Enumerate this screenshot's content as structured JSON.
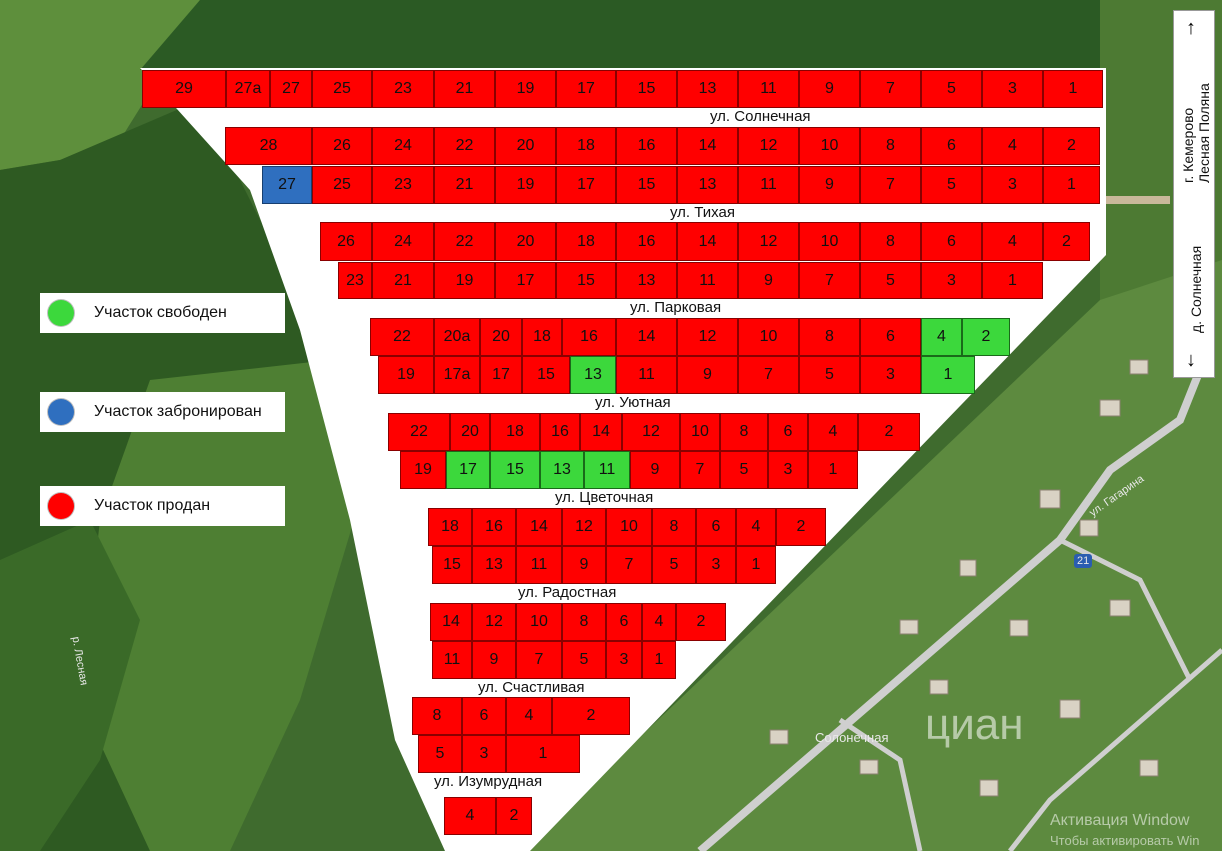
{
  "colors": {
    "sold": "#ff0000",
    "free": "#3cd83c",
    "reserved": "#2f6fbf",
    "street": "#ffffff",
    "forest": "#2e5a22",
    "field": "#5e8f3c"
  },
  "legend": [
    {
      "label": "Участок свободен",
      "color": "#3cd83c"
    },
    {
      "label": "Участок забронирован",
      "color": "#2f6fbf"
    },
    {
      "label": "Участок продан",
      "color": "#ff0000"
    }
  ],
  "streets": [
    "ул. Солнечная",
    "ул. Тихая",
    "ул. Парковая",
    "ул. Уютная",
    "ул. Цветочная",
    "ул. Радостная",
    "ул. Счастливая",
    "ул. Изумрудная"
  ],
  "direction": {
    "top_line1": "г. Кемерово",
    "top_line2": "Лесная Поляна",
    "bottom": "д. Солнечная",
    "up_arrow": "↑",
    "down_arrow": "↓"
  },
  "map_labels": {
    "road": "ул. Гагарина",
    "village_street": "Солонечная",
    "river": "р. Лесная",
    "route": "21"
  },
  "watermark": {
    "brand": "циан",
    "activation_line1": "Активация Window",
    "activation_line2": "Чтобы активировать Win"
  },
  "rows": [
    {
      "plots": [
        {
          "n": "29",
          "s": "sold"
        },
        {
          "n": "27а",
          "s": "sold"
        },
        {
          "n": "27",
          "s": "sold"
        },
        {
          "n": "25",
          "s": "sold"
        },
        {
          "n": "23",
          "s": "sold"
        },
        {
          "n": "21",
          "s": "sold"
        },
        {
          "n": "19",
          "s": "sold"
        },
        {
          "n": "17",
          "s": "sold"
        },
        {
          "n": "15",
          "s": "sold"
        },
        {
          "n": "13",
          "s": "sold"
        },
        {
          "n": "11",
          "s": "sold"
        },
        {
          "n": "9",
          "s": "sold"
        },
        {
          "n": "7",
          "s": "sold"
        },
        {
          "n": "5",
          "s": "sold"
        },
        {
          "n": "3",
          "s": "sold"
        },
        {
          "n": "1",
          "s": "sold"
        }
      ]
    },
    {
      "plots": [
        {
          "n": "28",
          "s": "sold"
        },
        {
          "n": "26",
          "s": "sold"
        },
        {
          "n": "24",
          "s": "sold"
        },
        {
          "n": "22",
          "s": "sold"
        },
        {
          "n": "20",
          "s": "sold"
        },
        {
          "n": "18",
          "s": "sold"
        },
        {
          "n": "16",
          "s": "sold"
        },
        {
          "n": "14",
          "s": "sold"
        },
        {
          "n": "12",
          "s": "sold"
        },
        {
          "n": "10",
          "s": "sold"
        },
        {
          "n": "8",
          "s": "sold"
        },
        {
          "n": "6",
          "s": "sold"
        },
        {
          "n": "4",
          "s": "sold"
        },
        {
          "n": "2",
          "s": "sold"
        }
      ]
    },
    {
      "plots": [
        {
          "n": "27",
          "s": "reserved"
        },
        {
          "n": "25",
          "s": "sold"
        },
        {
          "n": "23",
          "s": "sold"
        },
        {
          "n": "21",
          "s": "sold"
        },
        {
          "n": "19",
          "s": "sold"
        },
        {
          "n": "17",
          "s": "sold"
        },
        {
          "n": "15",
          "s": "sold"
        },
        {
          "n": "13",
          "s": "sold"
        },
        {
          "n": "11",
          "s": "sold"
        },
        {
          "n": "9",
          "s": "sold"
        },
        {
          "n": "7",
          "s": "sold"
        },
        {
          "n": "5",
          "s": "sold"
        },
        {
          "n": "3",
          "s": "sold"
        },
        {
          "n": "1",
          "s": "sold"
        }
      ]
    },
    {
      "plots": [
        {
          "n": "26",
          "s": "sold"
        },
        {
          "n": "24",
          "s": "sold"
        },
        {
          "n": "22",
          "s": "sold"
        },
        {
          "n": "20",
          "s": "sold"
        },
        {
          "n": "18",
          "s": "sold"
        },
        {
          "n": "16",
          "s": "sold"
        },
        {
          "n": "14",
          "s": "sold"
        },
        {
          "n": "12",
          "s": "sold"
        },
        {
          "n": "10",
          "s": "sold"
        },
        {
          "n": "8",
          "s": "sold"
        },
        {
          "n": "6",
          "s": "sold"
        },
        {
          "n": "4",
          "s": "sold"
        },
        {
          "n": "2",
          "s": "sold"
        }
      ]
    },
    {
      "plots": [
        {
          "n": "23",
          "s": "sold"
        },
        {
          "n": "21",
          "s": "sold"
        },
        {
          "n": "19",
          "s": "sold"
        },
        {
          "n": "17",
          "s": "sold"
        },
        {
          "n": "15",
          "s": "sold"
        },
        {
          "n": "13",
          "s": "sold"
        },
        {
          "n": "11",
          "s": "sold"
        },
        {
          "n": "9",
          "s": "sold"
        },
        {
          "n": "7",
          "s": "sold"
        },
        {
          "n": "5",
          "s": "sold"
        },
        {
          "n": "3",
          "s": "sold"
        },
        {
          "n": "1",
          "s": "sold"
        }
      ]
    },
    {
      "plots": [
        {
          "n": "22",
          "s": "sold"
        },
        {
          "n": "20а",
          "s": "sold"
        },
        {
          "n": "20",
          "s": "sold"
        },
        {
          "n": "18",
          "s": "sold"
        },
        {
          "n": "16",
          "s": "sold"
        },
        {
          "n": "14",
          "s": "sold"
        },
        {
          "n": "12",
          "s": "sold"
        },
        {
          "n": "10",
          "s": "sold"
        },
        {
          "n": "8",
          "s": "sold"
        },
        {
          "n": "6",
          "s": "sold"
        },
        {
          "n": "4",
          "s": "free"
        },
        {
          "n": "2",
          "s": "free"
        }
      ]
    },
    {
      "plots": [
        {
          "n": "19",
          "s": "sold"
        },
        {
          "n": "17а",
          "s": "sold"
        },
        {
          "n": "17",
          "s": "sold"
        },
        {
          "n": "15",
          "s": "sold"
        },
        {
          "n": "13",
          "s": "free"
        },
        {
          "n": "11",
          "s": "sold"
        },
        {
          "n": "9",
          "s": "sold"
        },
        {
          "n": "7",
          "s": "sold"
        },
        {
          "n": "5",
          "s": "sold"
        },
        {
          "n": "3",
          "s": "sold"
        },
        {
          "n": "1",
          "s": "free"
        }
      ]
    },
    {
      "plots": [
        {
          "n": "22",
          "s": "sold"
        },
        {
          "n": "20",
          "s": "sold"
        },
        {
          "n": "18",
          "s": "sold"
        },
        {
          "n": "16",
          "s": "sold"
        },
        {
          "n": "14",
          "s": "sold"
        },
        {
          "n": "12",
          "s": "sold"
        },
        {
          "n": "10",
          "s": "sold"
        },
        {
          "n": "8",
          "s": "sold"
        },
        {
          "n": "6",
          "s": "sold"
        },
        {
          "n": "4",
          "s": "sold"
        },
        {
          "n": "2",
          "s": "sold"
        }
      ]
    },
    {
      "plots": [
        {
          "n": "19",
          "s": "sold"
        },
        {
          "n": "17",
          "s": "free"
        },
        {
          "n": "15",
          "s": "free"
        },
        {
          "n": "13",
          "s": "free"
        },
        {
          "n": "11",
          "s": "free"
        },
        {
          "n": "9",
          "s": "sold"
        },
        {
          "n": "7",
          "s": "sold"
        },
        {
          "n": "5",
          "s": "sold"
        },
        {
          "n": "3",
          "s": "sold"
        },
        {
          "n": "1",
          "s": "sold"
        }
      ]
    },
    {
      "plots": [
        {
          "n": "18",
          "s": "sold"
        },
        {
          "n": "16",
          "s": "sold"
        },
        {
          "n": "14",
          "s": "sold"
        },
        {
          "n": "12",
          "s": "sold"
        },
        {
          "n": "10",
          "s": "sold"
        },
        {
          "n": "8",
          "s": "sold"
        },
        {
          "n": "6",
          "s": "sold"
        },
        {
          "n": "4",
          "s": "sold"
        },
        {
          "n": "2",
          "s": "sold"
        }
      ]
    },
    {
      "plots": [
        {
          "n": "15",
          "s": "sold"
        },
        {
          "n": "13",
          "s": "sold"
        },
        {
          "n": "11",
          "s": "sold"
        },
        {
          "n": "9",
          "s": "sold"
        },
        {
          "n": "7",
          "s": "sold"
        },
        {
          "n": "5",
          "s": "sold"
        },
        {
          "n": "3",
          "s": "sold"
        },
        {
          "n": "1",
          "s": "sold"
        }
      ]
    },
    {
      "plots": [
        {
          "n": "14",
          "s": "sold"
        },
        {
          "n": "12",
          "s": "sold"
        },
        {
          "n": "10",
          "s": "sold"
        },
        {
          "n": "8",
          "s": "sold"
        },
        {
          "n": "6",
          "s": "sold"
        },
        {
          "n": "4",
          "s": "sold"
        },
        {
          "n": "2",
          "s": "sold"
        }
      ]
    },
    {
      "plots": [
        {
          "n": "11",
          "s": "sold"
        },
        {
          "n": "9",
          "s": "sold"
        },
        {
          "n": "7",
          "s": "sold"
        },
        {
          "n": "5",
          "s": "sold"
        },
        {
          "n": "3",
          "s": "sold"
        },
        {
          "n": "1",
          "s": "sold"
        }
      ]
    },
    {
      "plots": [
        {
          "n": "8",
          "s": "sold"
        },
        {
          "n": "6",
          "s": "sold"
        },
        {
          "n": "4",
          "s": "sold"
        },
        {
          "n": "2",
          "s": "sold"
        }
      ]
    },
    {
      "plots": [
        {
          "n": "5",
          "s": "sold"
        },
        {
          "n": "3",
          "s": "sold"
        },
        {
          "n": "1",
          "s": "sold"
        }
      ]
    },
    {
      "plots": [
        {
          "n": "4",
          "s": "sold"
        },
        {
          "n": "2",
          "s": "sold"
        }
      ]
    }
  ]
}
